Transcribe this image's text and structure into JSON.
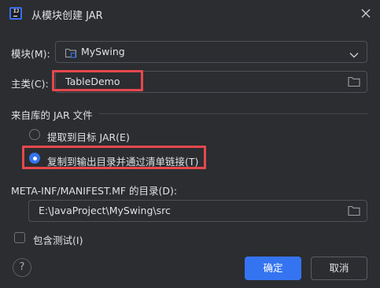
{
  "window": {
    "title": "从模块创建 JAR",
    "app_icon_text": "IJ",
    "close_icon": "close-icon"
  },
  "module": {
    "label": "模块(M):",
    "value": "MySwing",
    "icon": "module-folder-icon",
    "dropdown_icon": "chevron-down-icon"
  },
  "main_class": {
    "label": "主类(C):",
    "value": "TableDemo",
    "browse_icon": "folder-icon"
  },
  "libraries": {
    "section_title": "来自库的 JAR 文件",
    "options": [
      {
        "label": "提取到目标 JAR(E)",
        "selected": false
      },
      {
        "label": "复制到输出目录并通过清单链接(T)",
        "selected": true
      }
    ]
  },
  "manifest": {
    "label": "META-INF/MANIFEST.MF 的目录(D):",
    "value": "E:\\JavaProject\\MySwing\\src",
    "browse_icon": "folder-icon"
  },
  "include_tests": {
    "label": "包含测试(I)",
    "checked": false
  },
  "footer": {
    "help_label": "?",
    "ok_label": "确定",
    "cancel_label": "取消"
  },
  "colors": {
    "background": "#2b2d30",
    "accent": "#3574f0",
    "highlight": "#e5484d"
  }
}
